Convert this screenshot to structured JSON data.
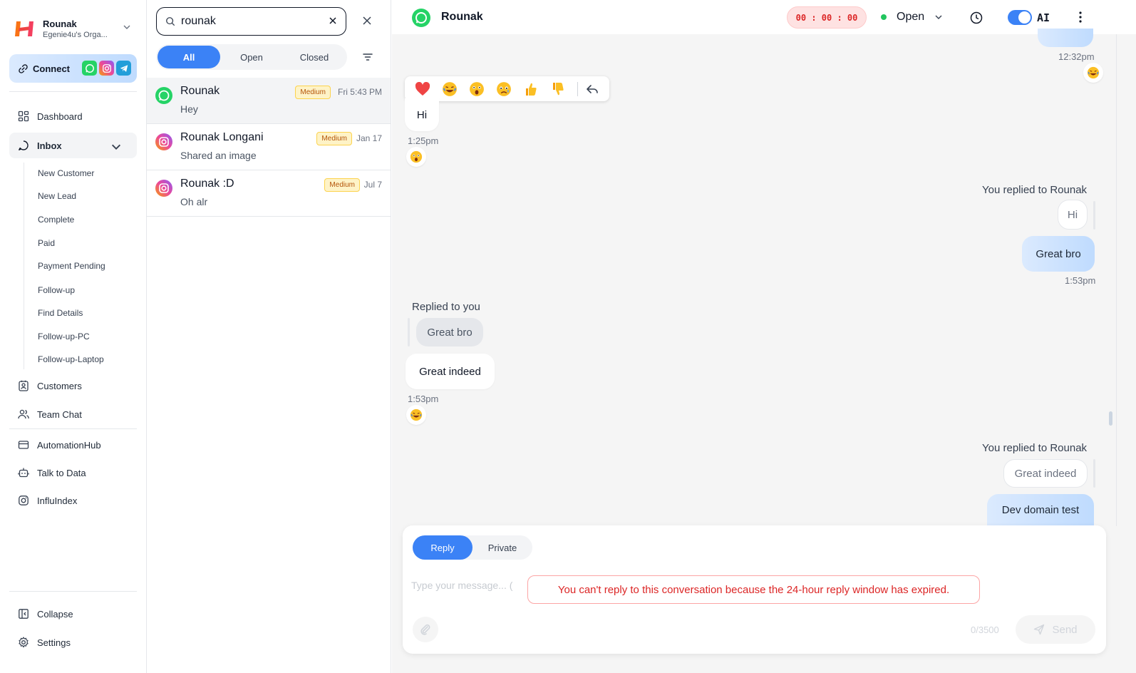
{
  "org": {
    "name": "Rounak",
    "subtitle": "Egenie4u's Orga..."
  },
  "connect": {
    "label": "Connect"
  },
  "nav": {
    "dashboard": "Dashboard",
    "inbox": "Inbox",
    "inbox_sub": [
      "New Customer",
      "New Lead",
      "Complete",
      "Paid",
      "Payment Pending",
      "Follow-up",
      "Find Details",
      "Follow-up-PC",
      "Follow-up-Laptop"
    ],
    "customers": "Customers",
    "team_chat": "Team Chat",
    "automation_hub": "AutomationHub",
    "talk_to_data": "Talk to Data",
    "influindex": "InfluIndex",
    "collapse": "Collapse",
    "settings": "Settings"
  },
  "search": {
    "value": "rounak"
  },
  "filters": {
    "all": "All",
    "open": "Open",
    "closed": "Closed"
  },
  "conversations": [
    {
      "name": "Rounak",
      "message": "Hey",
      "badge": "Medium",
      "time": "Fri 5:43 PM",
      "channel": "whatsapp"
    },
    {
      "name": "Rounak Longani",
      "message": "Shared an image",
      "badge": "Medium",
      "time": "Jan 17",
      "channel": "instagram"
    },
    {
      "name": "Rounak :D",
      "message": "Oh alr",
      "badge": "Medium",
      "time": "Jul 7",
      "channel": "instagram"
    }
  ],
  "chat": {
    "contact_name": "Rounak",
    "timer": "00 : 00 : 00",
    "status": "Open",
    "ai_label": "AI",
    "messages": {
      "ts_top": "12:32pm",
      "msg_hi": "Hi",
      "ts_hi": "1:25pm",
      "you_replied_1": "You replied to Rounak",
      "quote_hi": "Hi",
      "out_great_bro": "Great bro",
      "ts_great_bro": "1:53pm",
      "replied_to_you": "Replied to you",
      "quote_great_bro": "Great bro",
      "in_great_indeed": "Great indeed",
      "ts_great_indeed": "1:53pm",
      "you_replied_2": "You replied to Rounak",
      "quote_great_indeed": "Great indeed",
      "out_dev_domain": "Dev domain test"
    }
  },
  "composer": {
    "tab_reply": "Reply",
    "tab_private": "Private",
    "placeholder": "Type your message... (",
    "error": "You can't reply to this conversation because the 24-hour reply window has expired.",
    "counter": "0/3500",
    "send": "Send"
  },
  "colors": {
    "accent": "#3b82f6",
    "whatsapp": "#25D366",
    "telegram": "#229ED9",
    "error": "#dc2626",
    "open_status": "#22c55e"
  }
}
